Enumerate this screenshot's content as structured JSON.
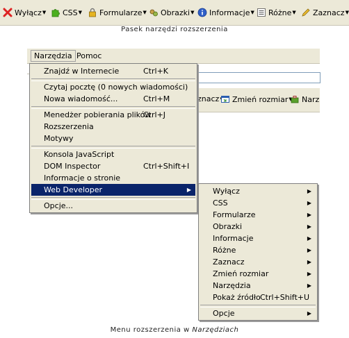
{
  "toolbar": {
    "items": [
      {
        "label": "Wyłącz",
        "icon": "disable-x-icon"
      },
      {
        "label": "CSS",
        "icon": "puzzle-icon"
      },
      {
        "label": "Formularze",
        "icon": "lock-icon"
      },
      {
        "label": "Obrazki",
        "icon": "image-icon"
      },
      {
        "label": "Informacje",
        "icon": "info-icon"
      },
      {
        "label": "Różne",
        "icon": "list-icon"
      },
      {
        "label": "Zaznacz",
        "icon": "pencil-icon"
      }
    ]
  },
  "caption_top": "Pasek narzędzi rozszerzenia",
  "menubar": {
    "items": [
      "Narzędzia",
      "Pomoc"
    ]
  },
  "wdbar": {
    "partial_label": "znacz",
    "resize_label": "Zmień rozmiar",
    "narz_label": "Narz"
  },
  "tools_menu": {
    "items": [
      {
        "label": "Znajdź w Internecie",
        "shortcut": "Ctrl+K"
      },
      {
        "label": "Czytaj pocztę (0 nowych wiadomości)",
        "shortcut": ""
      },
      {
        "label": "Nowa wiadomość...",
        "shortcut": "Ctrl+M"
      },
      {
        "label": "Menedżer pobierania plików",
        "shortcut": "Ctrl+J"
      },
      {
        "label": "Rozszerzenia",
        "shortcut": ""
      },
      {
        "label": "Motywy",
        "shortcut": ""
      },
      {
        "label": "Konsola JavaScript",
        "shortcut": ""
      },
      {
        "label": "DOM Inspector",
        "shortcut": "Ctrl+Shift+I"
      },
      {
        "label": "Informacje o stronie",
        "shortcut": ""
      },
      {
        "label": "Web Developer",
        "shortcut": ""
      },
      {
        "label": "Opcje...",
        "shortcut": ""
      }
    ]
  },
  "webdev_menu": {
    "items": [
      {
        "label": "Wyłącz"
      },
      {
        "label": "CSS"
      },
      {
        "label": "Formularze"
      },
      {
        "label": "Obrazki"
      },
      {
        "label": "Informacje"
      },
      {
        "label": "Różne"
      },
      {
        "label": "Zaznacz"
      },
      {
        "label": "Zmień rozmiar"
      },
      {
        "label": "Narzędzia"
      },
      {
        "label": "Pokaż źródło",
        "shortcut": "Ctrl+Shift+U"
      },
      {
        "label": "Opcje"
      }
    ]
  },
  "caption_bottom": {
    "text": "Menu rozszerzenia w",
    "italic": "Narzędziach"
  },
  "colors": {
    "highlight": "#0a246a",
    "menu_bg": "#ece9d8"
  }
}
